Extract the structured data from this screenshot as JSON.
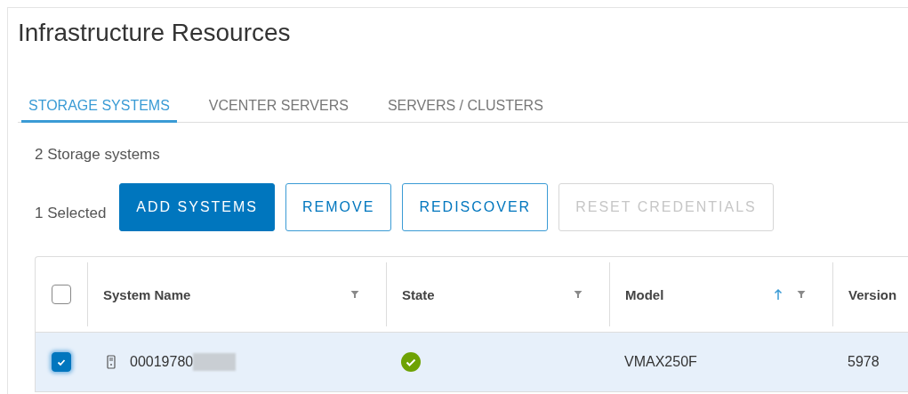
{
  "page": {
    "title": "Infrastructure Resources"
  },
  "tabs": [
    {
      "label": "STORAGE SYSTEMS",
      "selected": true
    },
    {
      "label": "VCENTER SERVERS",
      "selected": false
    },
    {
      "label": "SERVERS / CLUSTERS",
      "selected": false
    }
  ],
  "summary": "2 Storage systems",
  "selection_count": "1 Selected",
  "buttons": [
    {
      "label": "ADD SYSTEMS",
      "kind": "primary",
      "disabled": false
    },
    {
      "label": "REMOVE",
      "kind": "outlined",
      "disabled": false
    },
    {
      "label": "REDISCOVER",
      "kind": "outlined",
      "disabled": false
    },
    {
      "label": "RESET CREDENTIALS",
      "kind": "outlined",
      "disabled": true
    }
  ],
  "table": {
    "all_checked": false,
    "columns": [
      {
        "label": "System Name",
        "sorted": false,
        "filter": true
      },
      {
        "label": "State",
        "sorted": false,
        "filter": true
      },
      {
        "label": "Model",
        "sorted": true,
        "filter": true
      },
      {
        "label": "Version",
        "sorted": false,
        "filter": false
      }
    ],
    "rows": [
      {
        "checked": true,
        "selected": true,
        "name": "00019780",
        "redacted": true,
        "color": "#6ea204",
        "model": "VMAX250F",
        "version": "5978"
      }
    ]
  }
}
